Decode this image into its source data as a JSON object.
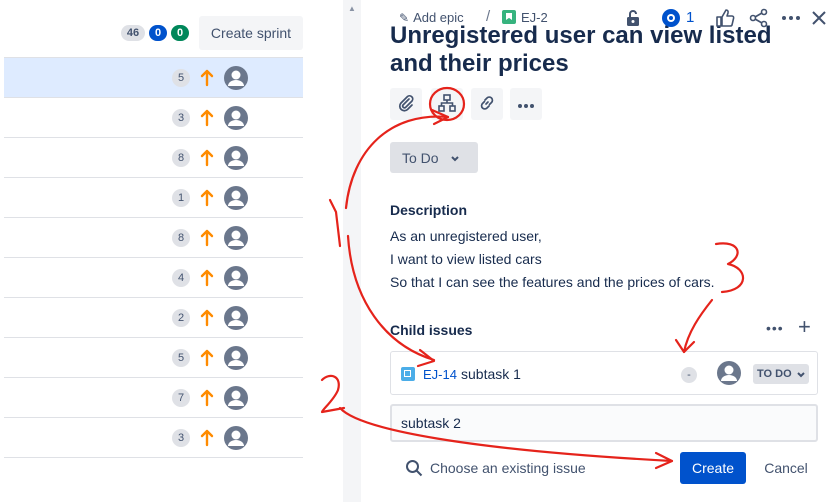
{
  "backlog": {
    "counts": {
      "total": "46",
      "in_progress": "0",
      "done": "0"
    },
    "create_sprint_label": "Create sprint",
    "rows": [
      {
        "points": "5",
        "priority": "medium-priority-icon",
        "selected": true
      },
      {
        "points": "3",
        "priority": "medium-priority-icon"
      },
      {
        "points": "8",
        "priority": "medium-priority-icon"
      },
      {
        "points": "1",
        "priority": "medium-priority-icon"
      },
      {
        "points": "8",
        "priority": "medium-priority-icon"
      },
      {
        "points": "4",
        "priority": "medium-priority-icon"
      },
      {
        "points": "2",
        "priority": "medium-priority-icon"
      },
      {
        "points": "5",
        "priority": "medium-priority-icon"
      },
      {
        "points": "7",
        "priority": "medium-priority-icon"
      },
      {
        "points": "3",
        "priority": "medium-priority-icon"
      }
    ]
  },
  "issue": {
    "add_epic_label": "Add epic",
    "breadcrumb_sep": "/",
    "key": "EJ-2",
    "watch_count": "1",
    "title_line1": "Unregistered user can view listed cars",
    "title_line2": "and their prices",
    "status_label": "To Do",
    "description_heading": "Description",
    "description_lines": [
      "As an unregistered user,",
      "I want to view listed cars",
      "So that I can see the features and the prices of cars."
    ],
    "child_issues_heading": "Child issues",
    "child_more": "•••",
    "child_add": "+",
    "child": {
      "key": "EJ-14",
      "summary": "subtask 1",
      "estimate": "-",
      "status": "TO DO"
    },
    "new_child_value": "subtask 2",
    "choose_existing_label": "Choose an existing issue",
    "create_label": "Create",
    "cancel_label": "Cancel"
  },
  "annotations": {
    "color": "#e5231b",
    "labels": [
      "1",
      "2",
      "3"
    ]
  },
  "colors": {
    "accent": "#0052cc",
    "selected_row": "#deebff",
    "priority_medium": "#ff8b00",
    "story": "#36b37e",
    "subtask": "#4bade8"
  }
}
